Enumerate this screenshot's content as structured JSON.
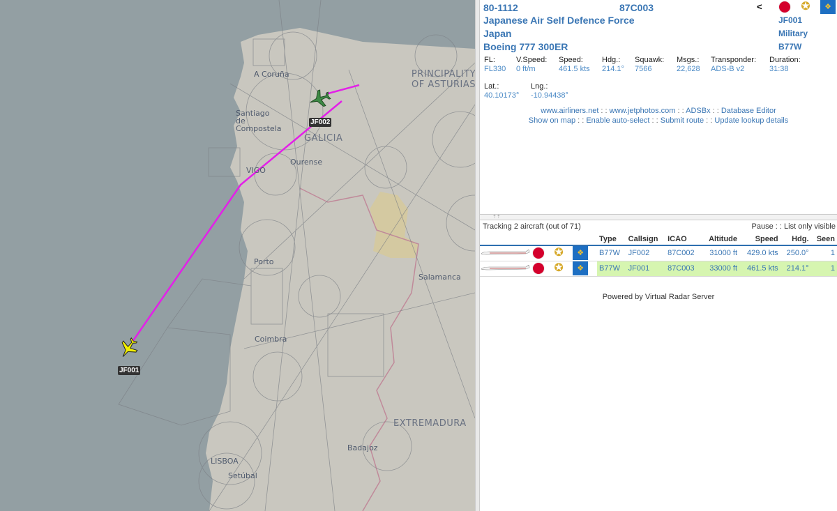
{
  "map": {
    "city_labels": [
      "A Coruña",
      "Santiago de Compostela",
      "Vigo",
      "Ourense",
      "Porto",
      "Salamanca",
      "Coimbra",
      "Lisboa",
      "Setúbal",
      "Badajoz"
    ],
    "region_labels": [
      "PRINCIPALITY OF ASTURIAS",
      "GALICIA",
      "EXTREMADURA"
    ],
    "aircraft": [
      {
        "callsign": "JF002",
        "color": "#3e8a45"
      },
      {
        "callsign": "JF001",
        "color": "#f3f000"
      }
    ],
    "trail_color": "#e320e8"
  },
  "detail": {
    "registration": "80-1112",
    "icao": "87C003",
    "operator": "Japanese Air Self Defence Force",
    "country": "Japan",
    "model": "Boeing 777 300ER",
    "callsign": "JF001",
    "species": "Military",
    "type": "B77W",
    "collapse_icon": "<",
    "fields": [
      {
        "label": "FL:",
        "value": "FL330"
      },
      {
        "label": "V.Speed:",
        "value": "0 ft/m"
      },
      {
        "label": "Speed:",
        "value": "461.5 kts"
      },
      {
        "label": "Hdg.:",
        "value": "214.1°"
      },
      {
        "label": "Squawk:",
        "value": "7566"
      },
      {
        "label": "Msgs.:",
        "value": "22,628"
      },
      {
        "label": "Transponder:",
        "value": "ADS-B v2"
      },
      {
        "label": "Duration:",
        "value": "31:38"
      }
    ],
    "position": [
      {
        "label": "Lat.:",
        "value": "40.10173°"
      },
      {
        "label": "Lng.:",
        "value": "-10.94438°"
      }
    ],
    "links_row1": [
      "www.airliners.net",
      "www.jetphotos.com",
      "ADSBx",
      "Database Editor"
    ],
    "links_row2": [
      "Show on map",
      "Enable auto-select",
      "Submit route",
      "Update lookup details"
    ],
    "separator": " : : "
  },
  "list": {
    "splitter_glyph": "⇡⇡",
    "tracking_text": "Tracking 2 aircraft (out of 71)",
    "pause_label": "Pause",
    "list_only_visible_label": "List only visible",
    "separator": " : : ",
    "columns": [
      "Type",
      "Callsign",
      "ICAO",
      "Altitude",
      "Speed",
      "Hdg.",
      "Seen"
    ],
    "rows": [
      {
        "type": "B77W",
        "callsign": "JF002",
        "icao": "87C002",
        "altitude": "31000 ft",
        "speed": "429.0 kts",
        "hdg": "250.0°",
        "seen": "1",
        "selected": false
      },
      {
        "type": "B77W",
        "callsign": "JF001",
        "icao": "87C003",
        "altitude": "33000 ft",
        "speed": "461.5 kts",
        "hdg": "214.1°",
        "seen": "1",
        "selected": true
      }
    ],
    "powered_by": "Powered by Virtual Radar Server"
  }
}
